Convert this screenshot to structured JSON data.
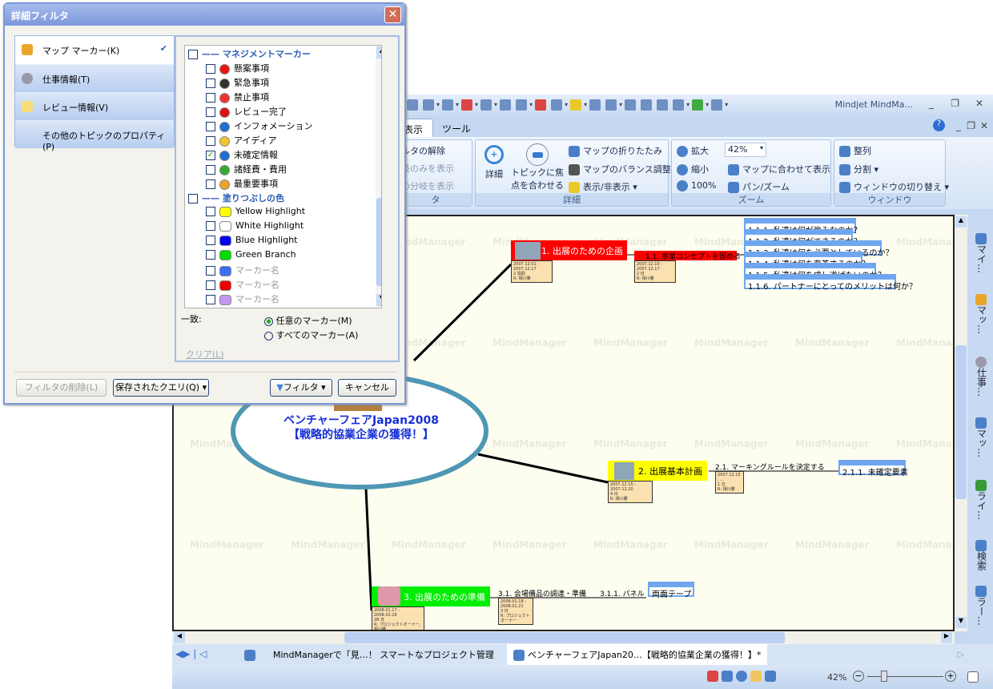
{
  "app": {
    "title": "Mindjet MindMa...",
    "tabs": [
      "表示",
      "ツール"
    ],
    "ribbon": {
      "filter_group": {
        "label": "タ",
        "items": [
          "ルタの解除",
          "岐のみを表示",
          "の分岐を表示"
        ]
      },
      "detail_group": {
        "label": "詳細",
        "detail_button": "詳細",
        "focus_button": "トピックに焦点を合わせる",
        "collapse": "マップの折りたたみ",
        "balance": "マップのバランス調整",
        "show_hide": "表示/非表示"
      },
      "zoom_group": {
        "label": "ズーム",
        "zoom_in": "拡大",
        "zoom_out": "縮小",
        "zoom_100": "100%",
        "zoom_value": "42%",
        "fit": "マップに合わせて表示",
        "pan_zoom": "パン/ズーム"
      },
      "window_group": {
        "label": "ウィンドウ",
        "arrange": "整列",
        "split": "分割",
        "switch": "ウィンドウの切り替え"
      }
    },
    "side_panel": [
      "マイ…",
      "マッ…",
      "仕事…",
      "マッ…",
      "ライ…",
      "検索",
      "ラー…"
    ],
    "doc_tabs": [
      "MindManagerで「見…！ スマートなプロジェクト管理",
      "ベンチャーフェアJapan20…【戦略的協業企業の獲得！】*"
    ],
    "status": {
      "zoom": "42%"
    }
  },
  "map": {
    "watermark": "MindManager",
    "central": {
      "logo": "ベンチャーフェア Japan2008",
      "line1": "ベンチャーフェアJapan2008",
      "line2": "【戦略的協業企業の獲得！】"
    },
    "topics": [
      {
        "label": "1. 出展のための企画",
        "color": "#ff0000",
        "info": [
          "2007.12.01 : 2007.12.17",
          "2 週間",
          "R: 相川勝"
        ],
        "sub": {
          "label": "1.1. 事業コンセプトを固める",
          "info": [
            "2007.12.10 : 2007.12.17",
            "2 日",
            "R: 相川勝"
          ],
          "children": [
            "1.1.1. 私達は何が強みなのか？",
            "1.1.2. 私達は何ができるのか？",
            "1.1.3. 私達は何を必要としているのか？",
            "1.1.4. 私達は何を変革するのか？",
            "1.1.5. 私達は何を成し遂げたいのか？",
            "1.1.6. パートナーにとってのメリットは何か？"
          ]
        }
      },
      {
        "label": "2. 出展基本計画",
        "color": "#ffff00",
        "info": [
          "2007.12.15 : 2007.12.20",
          "4 日",
          "R: 相川勝"
        ],
        "sub": {
          "label": "2.1. マーキングルールを決定する",
          "info": [
            "2007.12.15 : ...",
            "1 日",
            "R: 相川勝"
          ],
          "children": [
            "2.1.1. 未確定要素"
          ]
        }
      },
      {
        "label": "3. 出展のための準備",
        "color": "#00ee00",
        "info": [
          "2008.01.17 : 2008.02.26",
          "28 日",
          "R: プロジェクトオーナー, 相川勝"
        ],
        "sub": {
          "label": "3.1. 会場備品の調達・準備",
          "info": [
            "2008.01.18 : 2008.01.21",
            "3 日",
            "R: プロジェクトオーナー"
          ],
          "sub2": "3.1.1. パネル",
          "children": [
            "両面テープ"
          ]
        }
      }
    ]
  },
  "dialog": {
    "title": "詳細フィルタ",
    "nav": [
      "マップ マーカー(K)",
      "仕事情報(T)",
      "レビュー情報(V)",
      "その他のトピックのプロパティ(P)"
    ],
    "groups": [
      {
        "name": "マネジメントマーカー",
        "items": [
          {
            "label": "懸案事項",
            "checked": false,
            "icon": "stop"
          },
          {
            "label": "緊急事項",
            "checked": false,
            "icon": "bomb"
          },
          {
            "label": "禁止事項",
            "checked": false,
            "icon": "prohibited"
          },
          {
            "label": "レビュー完了",
            "checked": false,
            "icon": "check"
          },
          {
            "label": "インフォメーション",
            "checked": false,
            "icon": "info"
          },
          {
            "label": "アイディア",
            "checked": false,
            "icon": "bulb"
          },
          {
            "label": "未確定情報",
            "checked": true,
            "icon": "question"
          },
          {
            "label": "諸経費・費用",
            "checked": false,
            "icon": "dollar"
          },
          {
            "label": "最重要事項",
            "checked": false,
            "icon": "key"
          }
        ]
      },
      {
        "name": "塗りつぶしの色",
        "items": [
          {
            "label": "Yellow Highlight",
            "color": "#ffff00"
          },
          {
            "label": "White Highlight",
            "color": "#ffffff"
          },
          {
            "label": "Blue Highlight",
            "color": "#0000ee"
          },
          {
            "label": "Green Branch",
            "color": "#00dd00"
          },
          {
            "label": "マーカー名",
            "color": "#3a6ff0"
          },
          {
            "label": "マーカー名",
            "color": "#ee0000"
          },
          {
            "label": "マーカー名",
            "color": "#c596f0"
          }
        ]
      }
    ],
    "match_label": "一致:",
    "match_any": "任意のマーカー(M)",
    "match_all": "すべてのマーカー(A)",
    "clear": "クリア(L)",
    "remove_filter": "フィルタの削除(L)",
    "saved_query": "保存されたクエリ(Q)",
    "filter": "フィルタ",
    "cancel": "キャンセル"
  }
}
